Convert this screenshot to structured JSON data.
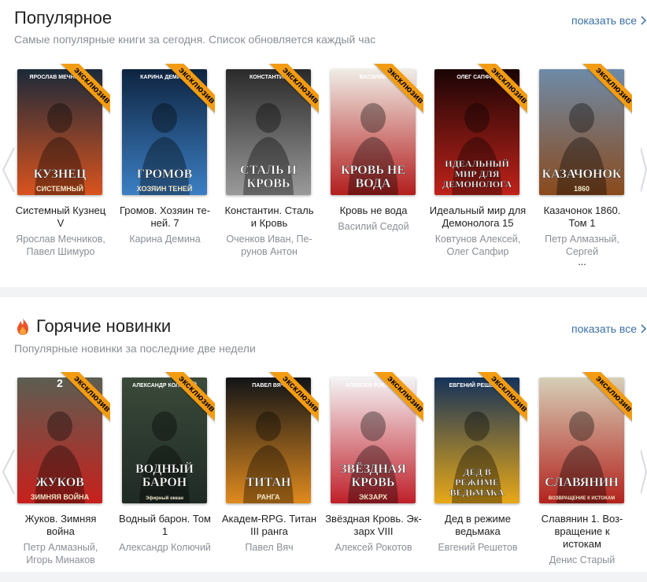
{
  "popular": {
    "title": "Популярное",
    "subtitle": "Самые популярные книги за сегодня. Список обновляется каждый час",
    "show_all": "показать все",
    "badge": "эксклюзив",
    "books": [
      {
        "title_lines": [
          "Системный Кузнец",
          "V"
        ],
        "author_lines": [
          "Ярослав Мечников,",
          "Павел Шимуро"
        ],
        "cover_top": "ЯРОСЛАВ МЕЧНИКОВ",
        "cover_big": "КУЗНЕЦ",
        "cover_small": "СИСТЕМНЫЙ",
        "colors": [
          "#1b2a3a",
          "#d9531e"
        ]
      },
      {
        "title_lines": [
          "Громов. Хозяин те-",
          "ней. 7"
        ],
        "author_lines": [
          "Карина Демина"
        ],
        "cover_top": "КАРИНА ДЕМИНА",
        "cover_big": "ГРОМОВ",
        "cover_small": "ХОЗЯИН ТЕНЕЙ",
        "colors": [
          "#0e2440",
          "#3b7fc4"
        ]
      },
      {
        "title_lines": [
          "Константин. Сталь",
          "и Кровь"
        ],
        "author_lines": [
          "Оченков Иван, Пе-",
          "рунов Антон"
        ],
        "cover_top": "КОНСТАНТИН",
        "cover_big": "СТАЛЬ И КРОВЬ",
        "cover_small": "",
        "colors": [
          "#2a2a2a",
          "#9a9a9a"
        ]
      },
      {
        "title_lines": [
          "Кровь не вода"
        ],
        "author_lines": [
          "Василий Седой"
        ],
        "cover_top": "ВАСИЛИЙ",
        "cover_big": "КРОВЬ НЕ ВОДА",
        "cover_small": "",
        "colors": [
          "#f0ede6",
          "#b31e1e"
        ]
      },
      {
        "title_lines": [
          "Идеальный мир для",
          "Демонолога 15"
        ],
        "author_lines": [
          "Ковтунов Алексей,",
          "Олег Сапфир"
        ],
        "cover_top": "ОЛЕГ САПФИР",
        "cover_big": "ИДЕАЛЬНЫЙ МИР ДЛЯ ДЕМОНОЛОГА",
        "cover_small": "",
        "colors": [
          "#1a0505",
          "#c0221a"
        ]
      },
      {
        "title_lines": [
          "Казачонок 1860.",
          "Том 1"
        ],
        "author_lines": [
          "Петр Алмазный,",
          "Сергей",
          "..."
        ],
        "cover_top": "",
        "cover_big": "КАЗАЧОНОК",
        "cover_small": "1860",
        "colors": [
          "#6e8ba8",
          "#8a4a1c"
        ]
      }
    ]
  },
  "hot": {
    "title": "Горячие новинки",
    "subtitle": "Популярные новинки за последние две недели",
    "show_all": "показать все",
    "badge": "эксклюзив",
    "books": [
      {
        "title_lines": [
          "Жуков. Зимняя",
          "война"
        ],
        "author_lines": [
          "Петр Алмазный,",
          "Игорь Минаков"
        ],
        "cover_top": "2",
        "cover_big": "ЖУКОВ",
        "cover_small": "ЗИМНЯЯ ВОЙНА",
        "colors": [
          "#5c5e52",
          "#c8201c"
        ]
      },
      {
        "title_lines": [
          "Водный барон. Том",
          "1"
        ],
        "author_lines": [
          "Александр Колючий"
        ],
        "cover_top": "АЛЕКСАНДР КОЛЮЧИЙ",
        "cover_big": "ВОДНЫЙ БАРОН",
        "cover_small": "Эфирный океан",
        "colors": [
          "#3b4a3a",
          "#1f2a25"
        ]
      },
      {
        "title_lines": [
          "Академ-RPG. Титан",
          "III ранга"
        ],
        "author_lines": [
          "Павел Вяч"
        ],
        "cover_top": "ПАВЕЛ ВЯЧ",
        "cover_big": "ТИТАН",
        "cover_small": "РАНГА",
        "colors": [
          "#111418",
          "#e08a1e"
        ]
      },
      {
        "title_lines": [
          "Звёздная Кровь. Эк-",
          "зарх VIII"
        ],
        "author_lines": [
          "Алексей Рокотов"
        ],
        "cover_top": "АЛЕКСЕЙ РОКОТОВ",
        "cover_big": "ЗВЁЗДНАЯ КРОВЬ",
        "cover_small": "ЭКЗАРХ",
        "colors": [
          "#f4f4f6",
          "#c0202a"
        ]
      },
      {
        "title_lines": [
          "Дед в режиме",
          "ведьмака"
        ],
        "author_lines": [
          "Евгений Решетов"
        ],
        "cover_top": "ЕВГЕНИЙ РЕШЕТОВ",
        "cover_big": "ДЕД В РЕЖИМЕ ВЕДЬМАКА",
        "cover_small": "",
        "colors": [
          "#14325a",
          "#e8a818"
        ]
      },
      {
        "title_lines": [
          "Славянин 1. Воз-",
          "вращение к",
          "истокам"
        ],
        "author_lines": [
          "Денис Старый"
        ],
        "cover_top": "",
        "cover_big": "СЛАВЯНИН",
        "cover_small": "ВОЗВРАЩЕНИЕ К ИСТОКАМ",
        "colors": [
          "#d6cfb8",
          "#b3231d"
        ]
      }
    ]
  },
  "icons": {
    "fire": "fire-icon",
    "chevron_right": "chevron-right-icon",
    "arrow_left": "carousel-prev-icon"
  }
}
